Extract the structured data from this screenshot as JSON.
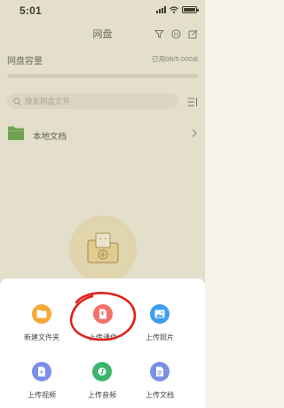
{
  "status_bar": {
    "time": "5:01"
  },
  "nav": {
    "title": "网盘"
  },
  "storage": {
    "title": "网盘容量",
    "usage": "已用0B/5.00GB",
    "used_fraction": 0.0
  },
  "search": {
    "placeholder": "搜索网盘文件"
  },
  "file_list": [
    {
      "label": "本地文档"
    }
  ],
  "action_sheet": {
    "items": [
      {
        "label": "新建文件夹",
        "icon": "folder-icon",
        "color": "#f7a83a"
      },
      {
        "label": "上传课件",
        "icon": "courseware-icon",
        "color": "#f2726a"
      },
      {
        "label": "上传照片",
        "icon": "photo-icon",
        "color": "#3f9df0"
      },
      {
        "label": "上传视频",
        "icon": "video-icon",
        "color": "#7b8ee8"
      },
      {
        "label": "上传音频",
        "icon": "music-icon",
        "color": "#3db56c"
      },
      {
        "label": "上传文档",
        "icon": "document-icon",
        "color": "#7a8fe6"
      }
    ]
  },
  "colors": {
    "annotation": "#e0201b",
    "folder_green": "#58a044"
  }
}
